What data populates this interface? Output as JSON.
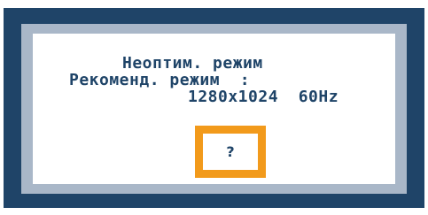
{
  "message": {
    "line1": "Неоптим. режим",
    "line2": "Рекоменд. режим  :",
    "line3": "1280x1024  60Hz"
  },
  "help": {
    "label": "?"
  },
  "colors": {
    "frame": "#1f4468",
    "panel": "#a9b7c8",
    "content": "#ffffff",
    "text": "#1f4468",
    "highlight": "#f29a1b"
  }
}
